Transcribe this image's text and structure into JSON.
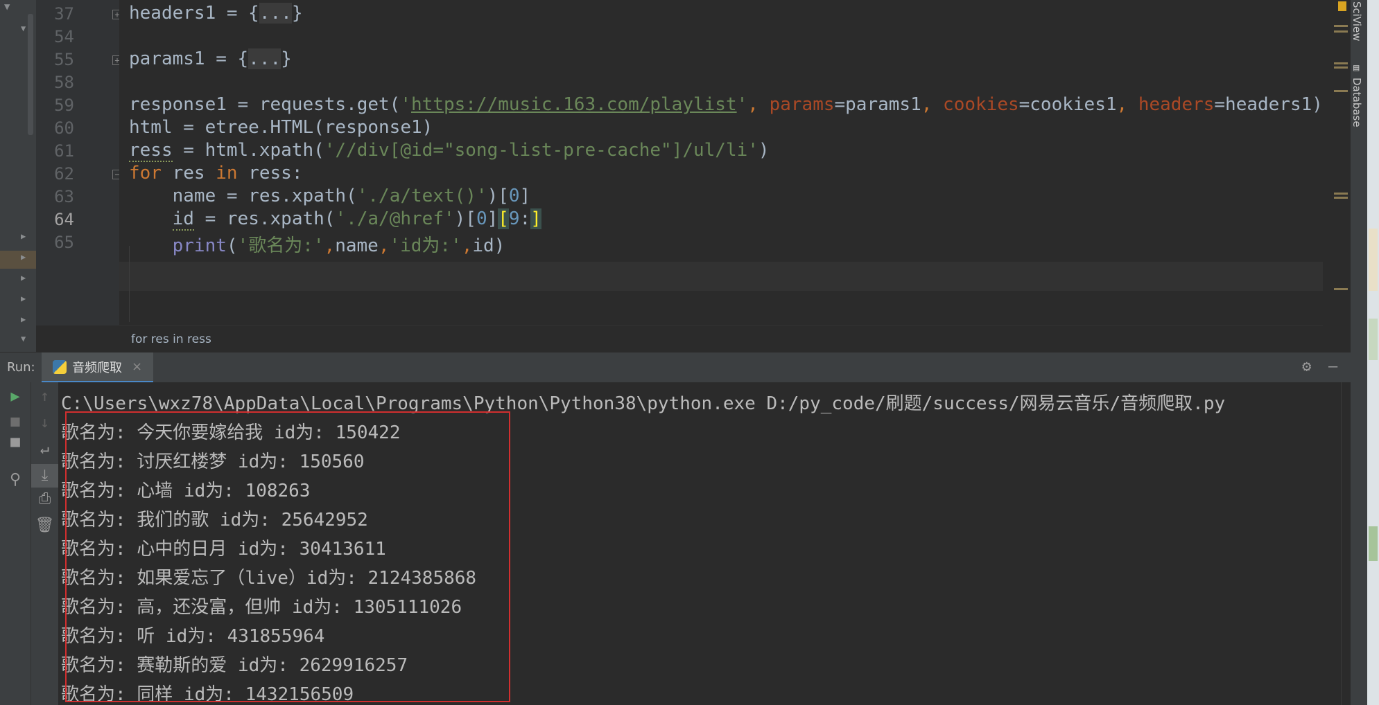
{
  "editor": {
    "lines": [
      {
        "num": "37",
        "fold": "+",
        "segs": [
          [
            "t",
            "headers1 = {"
          ],
          [
            "fold",
            "..."
          ],
          [
            "t",
            "}"
          ]
        ]
      },
      {
        "num": "54",
        "segs": []
      },
      {
        "num": "55",
        "fold": "+",
        "segs": [
          [
            "t",
            "params1 = {"
          ],
          [
            "fold",
            "..."
          ],
          [
            "t",
            "}"
          ]
        ]
      },
      {
        "num": "58",
        "segs": []
      },
      {
        "num": "59",
        "segs": [
          [
            "t",
            "response1 = requests.get("
          ],
          [
            "str",
            "'"
          ],
          [
            "url",
            "https://music.163.com/playlist"
          ],
          [
            "str",
            "'"
          ],
          [
            "kw",
            ", "
          ],
          [
            "param",
            "params"
          ],
          [
            "t",
            "=params1"
          ],
          [
            "kw",
            ", "
          ],
          [
            "param",
            "cookies"
          ],
          [
            "t",
            "=cookies1"
          ],
          [
            "kw",
            ", "
          ],
          [
            "param",
            "headers"
          ],
          [
            "t",
            "=headers1)"
          ]
        ]
      },
      {
        "num": "60",
        "segs": [
          [
            "t",
            "html = etree.HTML(response1)"
          ]
        ]
      },
      {
        "num": "61",
        "segs": [
          [
            "squig",
            "ress"
          ],
          [
            "t",
            " = html.xpath("
          ],
          [
            "str",
            "'//div[@id=\"song-list-pre-cache\"]/ul/li'"
          ],
          [
            "t",
            ")"
          ]
        ]
      },
      {
        "num": "62",
        "fold": "-",
        "segs": [
          [
            "kw",
            "for"
          ],
          [
            "t",
            " res "
          ],
          [
            "kw",
            "in"
          ],
          [
            "t",
            " ress:"
          ]
        ]
      },
      {
        "num": "63",
        "segs": [
          [
            "t",
            "    name = res.xpath("
          ],
          [
            "str",
            "'./a/text()'"
          ],
          [
            "t",
            ")["
          ],
          [
            "num",
            "0"
          ],
          [
            "t",
            "]"
          ]
        ]
      },
      {
        "num": "64",
        "current": true,
        "segs": [
          [
            "t",
            "    "
          ],
          [
            "squig",
            "id"
          ],
          [
            "t",
            " = res.xpath("
          ],
          [
            "str",
            "'./a/@href'"
          ],
          [
            "t",
            ")["
          ],
          [
            "num",
            "0"
          ],
          [
            "t",
            "]"
          ],
          [
            "brk",
            "["
          ],
          [
            "num",
            "9"
          ],
          [
            "t",
            ":"
          ],
          [
            "brk",
            "]"
          ]
        ]
      },
      {
        "num": "65",
        "segs": [
          [
            "t",
            "    "
          ],
          [
            "builtin",
            "print"
          ],
          [
            "t",
            "("
          ],
          [
            "str",
            "'歌名为:'"
          ],
          [
            "kw",
            ","
          ],
          [
            "t",
            "name"
          ],
          [
            "kw",
            ","
          ],
          [
            "str",
            "'id为:'"
          ],
          [
            "kw",
            ","
          ],
          [
            "t",
            "id)"
          ]
        ]
      }
    ],
    "breadcrumb": "for res in ress"
  },
  "side_tabs": {
    "sciview": "SciView",
    "database": "Database"
  },
  "run_panel": {
    "label": "Run:",
    "tab_title": "音频爬取",
    "close": "×",
    "command": "C:\\Users\\wxz78\\AppData\\Local\\Programs\\Python\\Python38\\python.exe D:/py_code/刷题/success/网易云音乐/音频爬取.py",
    "output": [
      "歌名为: 今天你要嫁给我 id为: 150422",
      "歌名为: 讨厌红楼梦 id为: 150560",
      "歌名为: 心墙 id为: 108263",
      "歌名为: 我们的歌 id为: 25642952",
      "歌名为: 心中的日月 id为: 30413611",
      "歌名为: 如果爱忘了（live）id为: 2124385868",
      "歌名为: 高，还没富，但帅 id为: 1305111026",
      "歌名为: 听 id为: 431855964",
      "歌名为: 赛勒斯的爱 id为: 2629916257",
      "歌名为: 同样 id为: 1432156509"
    ]
  },
  "icons": {
    "run": "run-icon",
    "stop": "stop-icon",
    "layout": "layout-icon",
    "pin": "pin-icon",
    "up": "arrow-up-icon",
    "down": "arrow-down-icon",
    "wrap": "soft-wrap-icon",
    "scroll_end": "scroll-to-end-icon",
    "print": "print-icon",
    "trash": "trash-icon",
    "gear": "gear-icon",
    "minimize": "minimize-icon"
  },
  "colors": {
    "keyword": "#cc7832",
    "string": "#6a8759",
    "number": "#6897bb",
    "param": "#aa4926",
    "builtin": "#8888c6",
    "highlight_box": "#d22f2f"
  }
}
